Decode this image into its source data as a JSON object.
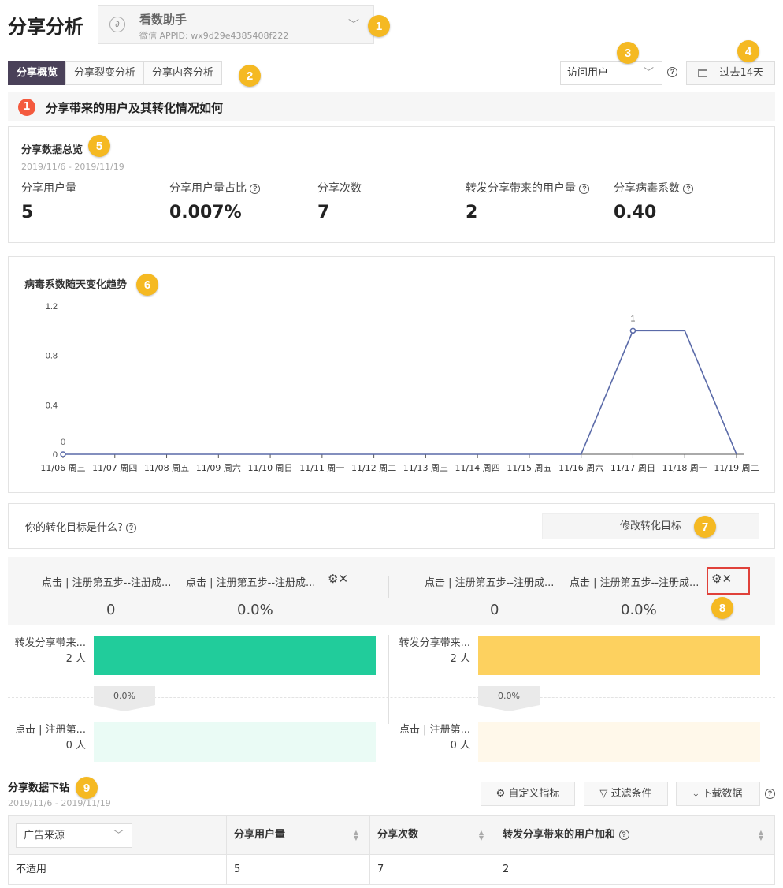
{
  "page": {
    "title": "分享分析"
  },
  "app_select": {
    "name": "看数助手",
    "appid": "微信 APPID: wx9d29e4385408f222"
  },
  "tabs": [
    "分享概览",
    "分享裂变分析",
    "分享内容分析"
  ],
  "user_select": {
    "value": "访问用户"
  },
  "date_button": {
    "label": "过去14天"
  },
  "section": {
    "number": "1",
    "title": "分享带来的用户及其转化情况如何"
  },
  "overview": {
    "title": "分享数据总览",
    "date_range": "2019/11/6 - 2019/11/19",
    "metrics": [
      {
        "label": "分享用户量",
        "value": "5",
        "help": false
      },
      {
        "label": "分享用户量占比",
        "value": "0.007%",
        "help": true
      },
      {
        "label": "分享次数",
        "value": "7",
        "help": false
      },
      {
        "label": "转发分享带来的用户量",
        "value": "2",
        "help": true
      },
      {
        "label": "分享病毒系数",
        "value": "0.40",
        "help": true
      }
    ]
  },
  "chart_data": {
    "type": "line",
    "title": "病毒系数随天变化趋势",
    "categories": [
      "11/06 周三",
      "11/07 周四",
      "11/08 周五",
      "11/09 周六",
      "11/10 周日",
      "11/11 周一",
      "11/12 周二",
      "11/13 周三",
      "11/14 周四",
      "11/15 周五",
      "11/16 周六",
      "11/17 周日",
      "11/18 周一",
      "11/19 周二"
    ],
    "values": [
      0,
      0,
      0,
      0,
      0,
      0,
      0,
      0,
      0,
      0,
      0,
      1,
      1,
      0
    ],
    "yticks": [
      "0",
      "0.4",
      "0.8",
      "1.2"
    ],
    "ylim": [
      0,
      1.2
    ],
    "point_labels": {
      "0": "0",
      "11": "1"
    },
    "line_color": "#5a6aa8"
  },
  "goal": {
    "question": "你的转化目标是什么?",
    "button": "修改转化目标"
  },
  "funnels": [
    {
      "head_labels": [
        "点击 | 注册第五步--注册成...",
        "点击 | 注册第五步--注册成..."
      ],
      "head_values": [
        "0",
        "0.0%"
      ],
      "step1_label": "转发分享带来...",
      "step1_count": "2 人",
      "conversion": "0.0%",
      "step2_label": "点击 | 注册第...",
      "step2_count": "0 人",
      "color": "#21cc9b",
      "color_light": "#eafbf5"
    },
    {
      "head_labels": [
        "点击 | 注册第五步--注册成...",
        "点击 | 注册第五步--注册成..."
      ],
      "head_values": [
        "0",
        "0.0%"
      ],
      "step1_label": "转发分享带来...",
      "step1_count": "2 人",
      "conversion": "0.0%",
      "step2_label": "点击 | 注册第...",
      "step2_count": "0 人",
      "color": "#fdd15f",
      "color_light": "#fff8ea"
    }
  ],
  "drill": {
    "title": "分享数据下钻",
    "date_range": "2019/11/6 - 2019/11/19",
    "buttons": [
      "自定义指标",
      "过滤条件",
      "下载数据"
    ],
    "source_select": "广告来源",
    "columns": [
      "分享用户量",
      "分享次数",
      "转发分享带来的用户加和"
    ],
    "rows": [
      [
        "不适用",
        "5",
        "7",
        "2"
      ]
    ]
  },
  "annotations": [
    "1",
    "2",
    "3",
    "4",
    "5",
    "6",
    "7",
    "8",
    "9"
  ]
}
